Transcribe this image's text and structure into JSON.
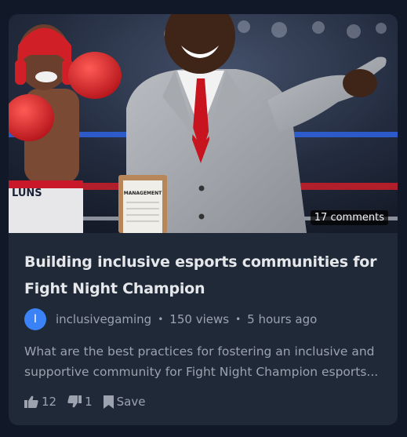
{
  "video": {
    "comments_badge": "17 comments",
    "title": "Building inclusive esports communities for Fight Night Champion",
    "channel": {
      "avatar_letter": "I",
      "name": "inclusivegaming",
      "avatar_color": "#3b82f6"
    },
    "views": "150 views",
    "separator": "•",
    "posted": "5 hours ago",
    "description": "What are the best practices for fostering an inclusive and supportive community for Fight Night Champion esports...",
    "likes": "12",
    "dislikes": "1",
    "save_label": "Save",
    "thumbnail_alt": "Boxing ring scene with a fighter in red gloves and a manager in a grey suit pointing",
    "thumbnail_clipboard_text": "MANAGEMENT",
    "thumbnail_shorts_text": "LUNS"
  },
  "colors": {
    "page_bg": "#111827",
    "card_bg": "#1f2937",
    "title": "#e5e7eb",
    "muted": "#9ca3af"
  }
}
